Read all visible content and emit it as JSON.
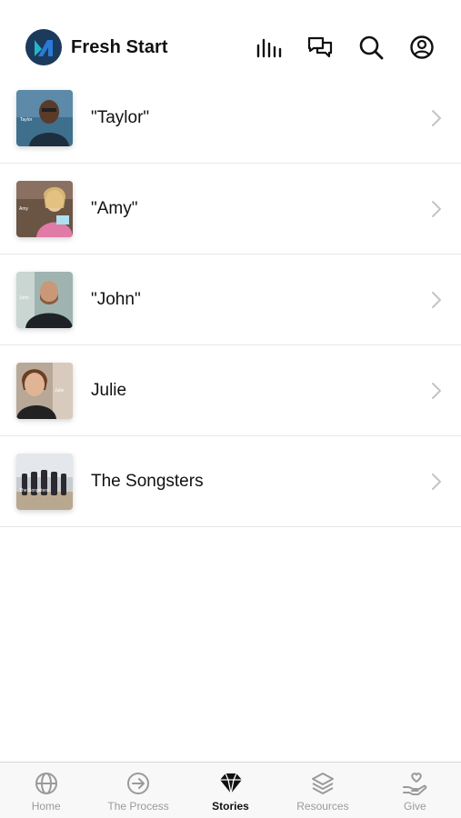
{
  "header": {
    "app_title": "Fresh Start",
    "icons": [
      "audio-bars-icon",
      "chat-icon",
      "search-icon",
      "profile-icon"
    ]
  },
  "stories": [
    {
      "label": "\"Taylor\"",
      "thumb_icon": "taylor-portrait"
    },
    {
      "label": "\"Amy\"",
      "thumb_icon": "amy-portrait"
    },
    {
      "label": "\"John\"",
      "thumb_icon": "john-portrait"
    },
    {
      "label": "Julie",
      "thumb_icon": "julie-portrait"
    },
    {
      "label": "The Songsters",
      "thumb_icon": "songsters-group"
    }
  ],
  "tabbar": {
    "tabs": [
      {
        "label": "Home",
        "icon": "globe-icon",
        "active": false
      },
      {
        "label": "The Process",
        "icon": "arrow-circle-icon",
        "active": false
      },
      {
        "label": "Stories",
        "icon": "diamond-icon",
        "active": true
      },
      {
        "label": "Resources",
        "icon": "layers-icon",
        "active": false
      },
      {
        "label": "Give",
        "icon": "heart-hand-icon",
        "active": false
      }
    ]
  },
  "colors": {
    "logo_bg": "#1b3a5c",
    "logo_accent": "#22b5c9",
    "active_tab": "#111111",
    "inactive_tab": "#9a9a9a"
  }
}
